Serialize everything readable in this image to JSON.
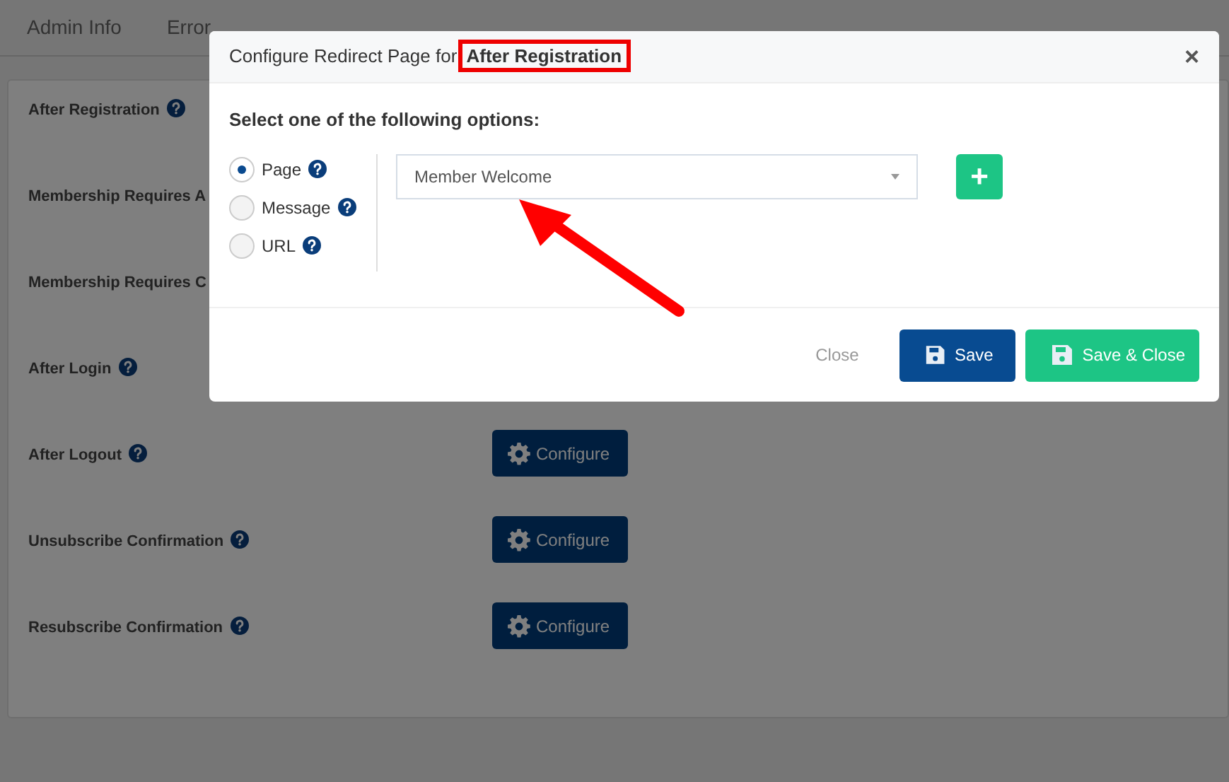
{
  "tabs": [
    {
      "label": "Admin Info",
      "selected": false
    },
    {
      "label": "Error",
      "selected": false
    }
  ],
  "settings": [
    {
      "label": "After Registration",
      "help": true
    },
    {
      "label": "Membership Requires A"
    },
    {
      "label": "Membership Requires C"
    },
    {
      "label": "After Login",
      "help": true
    },
    {
      "label": "After Logout",
      "help": true,
      "button": "Configure"
    },
    {
      "label": "Unsubscribe Confirmation",
      "help": true,
      "button": "Configure"
    },
    {
      "label": "Resubscribe Confirmation",
      "help": true,
      "button": "Configure"
    }
  ],
  "modal": {
    "title": "Configure Redirect Page for",
    "title_subject": "After Registration",
    "subject_highlighted": true,
    "close": "×",
    "prompt": "Select one of the following options:",
    "options": [
      {
        "label": "Page",
        "selected": true
      },
      {
        "label": "Message",
        "selected": false
      },
      {
        "label": "URL",
        "selected": false
      }
    ],
    "select": {
      "value": "Member Welcome"
    },
    "add_button": "+",
    "footer": {
      "close": "Close",
      "save": "Save",
      "save_close": "Save & Close"
    }
  },
  "annotations": [
    {
      "kind": "arrow"
    }
  ]
}
